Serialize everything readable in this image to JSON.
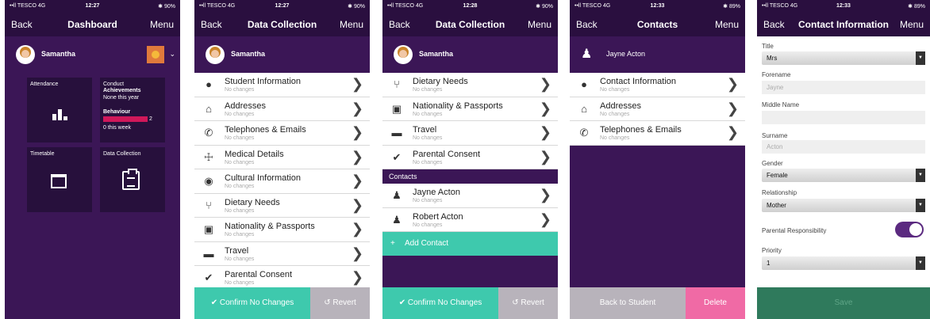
{
  "status": {
    "carrier": "••ll TESCO  4G",
    "times": [
      "12:27",
      "12:27",
      "12:28",
      "12:33",
      "12:33"
    ],
    "battery": [
      "✱ 90%",
      "✱ 90%",
      "✱ 90%",
      "✱ 89%",
      "✱ 89%"
    ]
  },
  "nav": {
    "back": "Back",
    "menu": "Menu",
    "titles": [
      "Dashboard",
      "Data Collection",
      "Data Collection",
      "Contacts",
      "Contact Information"
    ]
  },
  "user": {
    "name": "Samantha",
    "contact_name": "Jayne Acton"
  },
  "dashboard": {
    "attendance": "Attendance",
    "conduct": "Conduct",
    "achievements": "Achievements",
    "none_this_year": "None this year",
    "behaviour": "Behaviour",
    "behaviour_count": "2",
    "this_week": "0 this week",
    "timetable": "Timetable",
    "data_collection": "Data Collection"
  },
  "sub_no_changes": "No changes",
  "data_items": [
    {
      "label": "Student Information",
      "icon": "person-icon"
    },
    {
      "label": "Addresses",
      "icon": "home-icon"
    },
    {
      "label": "Telephones & Emails",
      "icon": "phone-icon"
    },
    {
      "label": "Medical Details",
      "icon": "medical-icon"
    },
    {
      "label": "Cultural Information",
      "icon": "globe-icon"
    },
    {
      "label": "Dietary Needs",
      "icon": "cutlery-icon"
    },
    {
      "label": "Nationality & Passports",
      "icon": "passport-icon"
    },
    {
      "label": "Travel",
      "icon": "car-icon"
    },
    {
      "label": "Parental Consent",
      "icon": "check-icon"
    }
  ],
  "contacts_section": "Contacts",
  "contacts": [
    "Jayne Acton",
    "Robert Acton"
  ],
  "add_contact": "Add Contact",
  "buttons": {
    "confirm": "Confirm No Changes",
    "revert": "Revert",
    "back_to_student": "Back to Student",
    "delete": "Delete",
    "save": "Save"
  },
  "contact_menu": [
    "Contact Information",
    "Addresses",
    "Telephones & Emails"
  ],
  "contact_form": {
    "title_label": "Title",
    "title_value": "Mrs",
    "forename_label": "Forename",
    "forename_value": "Jayne",
    "middle_label": "Middle Name",
    "surname_label": "Surname",
    "surname_value": "Acton",
    "gender_label": "Gender",
    "gender_value": "Female",
    "relationship_label": "Relationship",
    "relationship_value": "Mother",
    "parental_label": "Parental Responsibility",
    "parental_on": true,
    "priority_label": "Priority",
    "priority_value": "1"
  },
  "colors": {
    "purple": "#3b1656",
    "teal": "#3ec9ad",
    "pink": "#f06aa5",
    "grey": "#b8b3bb",
    "green": "#2f7a5c"
  }
}
